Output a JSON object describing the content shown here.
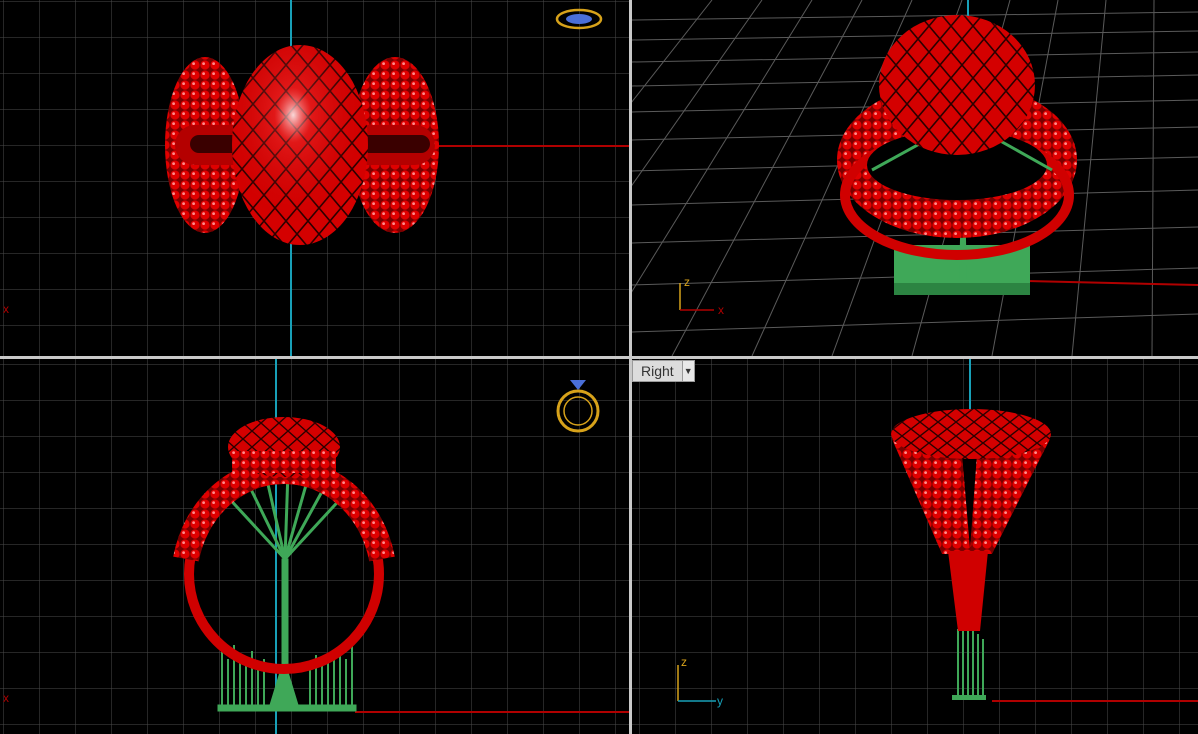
{
  "viewports": {
    "top": {
      "x_marker": "x"
    },
    "perspective": {
      "axis_x": "x",
      "axis_z": "z"
    },
    "front": {
      "x_marker": "x"
    },
    "right": {
      "label": "Right",
      "dropdown_icon": "chevron-down-icon",
      "axis_z": "z",
      "axis_y": "y"
    }
  },
  "colors": {
    "background": "#000000",
    "grid": "#4b4b4b",
    "grid_major": "#6a6a6a",
    "model": "#e00000",
    "supports": "#3fa858",
    "axis_x": "#b00000",
    "axis_y": "#18a0b8",
    "gizmo": "#d7a21a"
  }
}
